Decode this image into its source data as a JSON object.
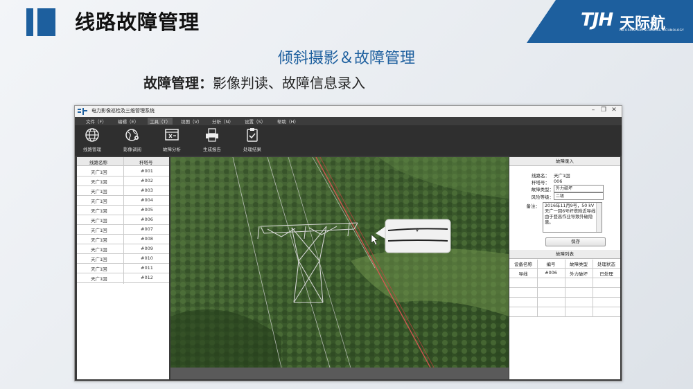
{
  "slide": {
    "title": "线路故障管理",
    "subtitle": "倾斜摄影＆故障管理",
    "desc_bold": "故障管理：",
    "desc_rest": "影像判读、故障信息录入",
    "logo_mark": "TJH",
    "logo_cn": "天际航",
    "logo_en": "INFORMATION SCIENCE&TECHNOLOGY",
    "accent_color": "#1d5f9e"
  },
  "window": {
    "app_title": "电力影像巡检及三维管理系统",
    "controls": [
      "minimize-icon",
      "maximize-icon",
      "close-icon"
    ],
    "menus": [
      "文件（F）",
      "编辑（E）",
      "工具（T）",
      "视图（V）",
      "分析（N）",
      "设置（S）",
      "帮助（H）"
    ],
    "active_menu_index": 2,
    "toolbar": [
      {
        "label": "线路管理",
        "icon": "globe-icon"
      },
      {
        "label": "影像调阅",
        "icon": "earth-pin-icon"
      },
      {
        "label": "故障分析",
        "icon": "fault-analysis-icon"
      },
      {
        "label": "生成报告",
        "icon": "printer-icon"
      },
      {
        "label": "处理结果",
        "icon": "clipboard-check-icon"
      }
    ]
  },
  "line_table": {
    "headers": [
      "线路名称",
      "杆塔号"
    ],
    "rows": [
      [
        "天广1回",
        "#001"
      ],
      [
        "天广1回",
        "#002"
      ],
      [
        "天广1回",
        "#003"
      ],
      [
        "天广1回",
        "#004"
      ],
      [
        "天广1回",
        "#005"
      ],
      [
        "天广1回",
        "#006"
      ],
      [
        "天广1回",
        "#007"
      ],
      [
        "天广1回",
        "#008"
      ],
      [
        "天广1回",
        "#009"
      ],
      [
        "天广1回",
        "#010"
      ],
      [
        "天广1回",
        "#011"
      ],
      [
        "天广1回",
        "#012"
      ]
    ]
  },
  "fault_entry": {
    "title": "故障录入",
    "line_name_label": "线路名：",
    "line_name": "天广1回",
    "tower_label": "杆塔号：",
    "tower_no": "006",
    "fault_type_label": "故障类型：",
    "fault_type": "外力破坏",
    "risk_label": "风险等级：",
    "risk_level": "二级",
    "note_label": "备注：",
    "note": "2016年11月9号，50 kV天广一回6号杆塔附近导线由于登高作业导致外破隐患。",
    "save_label": "保存"
  },
  "fault_list": {
    "title": "故障列表",
    "headers": [
      "设备名称",
      "编号",
      "故障类型",
      "处理状态"
    ],
    "rows": [
      [
        "导线",
        "#006",
        "外力破坏",
        "已处理"
      ]
    ]
  }
}
